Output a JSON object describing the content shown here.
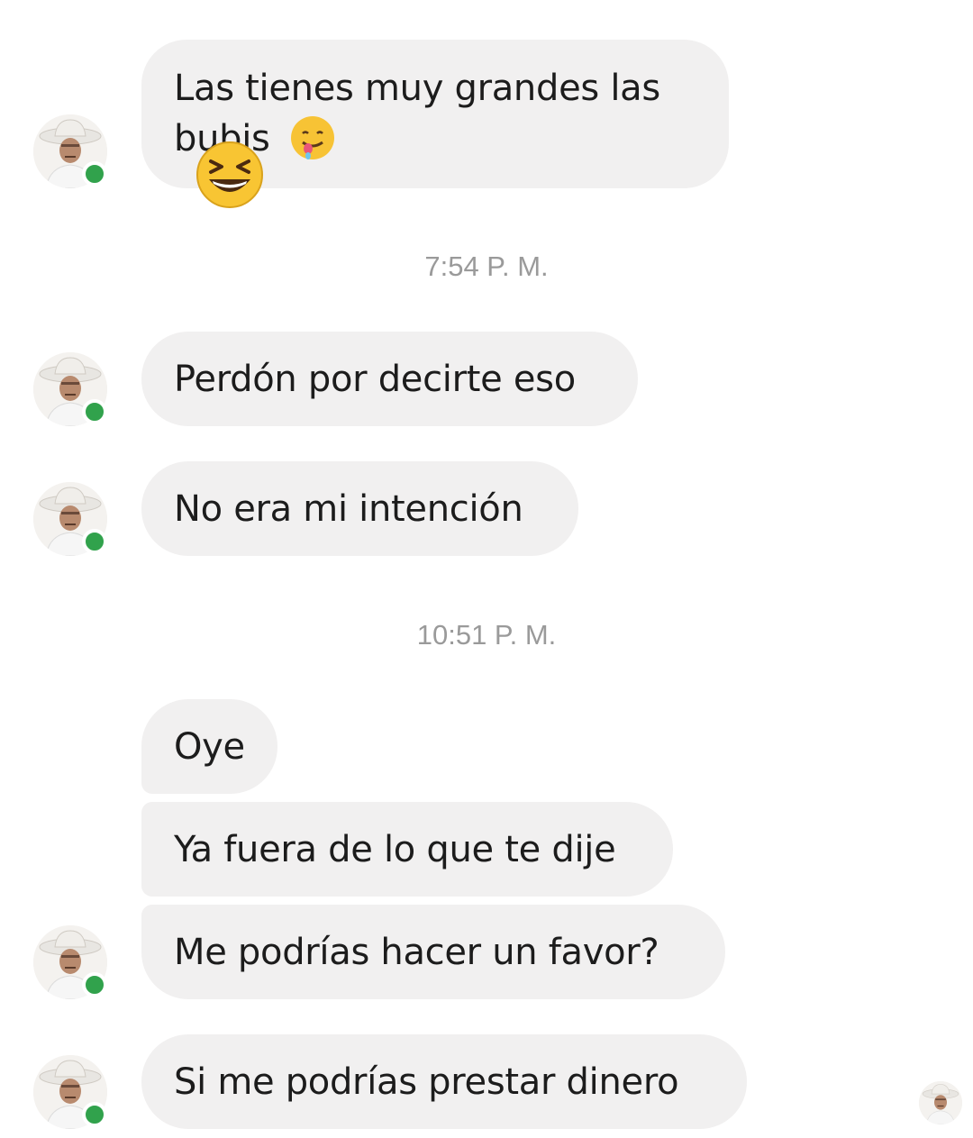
{
  "messages": [
    {
      "text": "Las tienes muy grandes las bubis"
    },
    {
      "text": "Perdón por decirte eso"
    },
    {
      "text": "No era mi intención"
    },
    {
      "text": "Oye"
    },
    {
      "text": "Ya fuera de lo que te dije"
    },
    {
      "text": "Me podrías hacer un favor?"
    },
    {
      "text": "Si me podrías prestar dinero"
    }
  ],
  "timestamps": [
    "7:54 P. M.",
    "10:51 P. M."
  ],
  "icons": {
    "inline_emoji": "drooling-face-icon",
    "reaction": "grinning-squinting-face-icon",
    "avatar": "cowboy-hat-man-avatar",
    "status": "online-status-dot"
  },
  "colors": {
    "bubble": "#f1f0f0",
    "text": "#1c1c1c",
    "timestamp": "#9a9a9a",
    "online": "#31a24c"
  }
}
